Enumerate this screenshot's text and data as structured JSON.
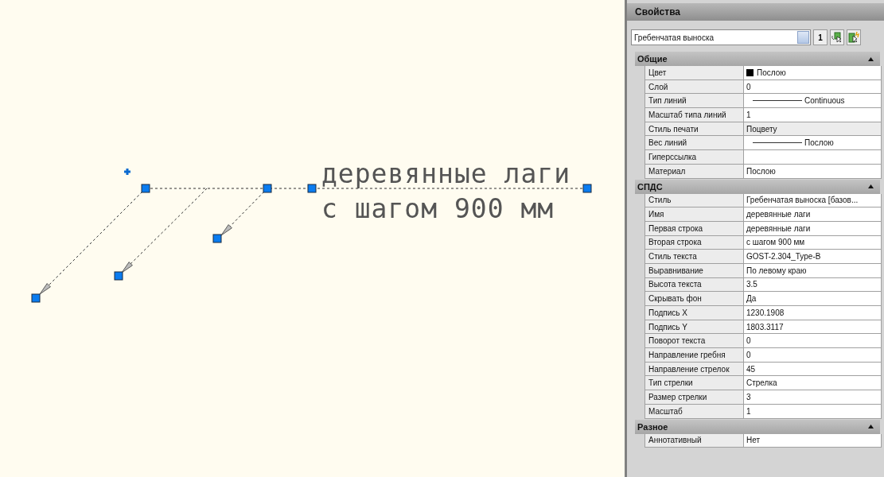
{
  "canvas": {
    "annotation_lines": [
      "деревянные лаги",
      "с шагом 900 мм"
    ]
  },
  "panel": {
    "title": "Свойства",
    "object_selector": {
      "value": "Гребенчатая выноска"
    },
    "toolbar": [
      {
        "kind": "number",
        "label": "1"
      },
      {
        "kind": "select-objects"
      },
      {
        "kind": "quick-select"
      }
    ],
    "sections": [
      {
        "title": "Общие",
        "expanded": true,
        "rows": [
          {
            "label": "Цвет",
            "value": "Послою",
            "kind": "color",
            "disabled": false
          },
          {
            "label": "Слой",
            "value": "0",
            "kind": "text",
            "disabled": false
          },
          {
            "label": "Тип линий",
            "value": "Continuous",
            "kind": "line",
            "disabled": false
          },
          {
            "label": "Масштаб типа линий",
            "value": "1",
            "kind": "text",
            "disabled": false
          },
          {
            "label": "Стиль печати",
            "value": "Поцвету",
            "kind": "text",
            "disabled": true
          },
          {
            "label": "Вес линий",
            "value": "Послою",
            "kind": "line",
            "disabled": false
          },
          {
            "label": "Гиперссылка",
            "value": "",
            "kind": "text",
            "disabled": false
          },
          {
            "label": "Материал",
            "value": "Послою",
            "kind": "text",
            "disabled": false
          }
        ]
      },
      {
        "title": "СПДС",
        "expanded": true,
        "rows": [
          {
            "label": "Стиль",
            "value": "Гребенчатая выноска [базов...",
            "kind": "text",
            "disabled": false
          },
          {
            "label": "Имя",
            "value": "деревянные лаги",
            "kind": "text",
            "disabled": false
          },
          {
            "label": "Первая строка",
            "value": "деревянные лаги",
            "kind": "text",
            "disabled": false
          },
          {
            "label": "Вторая строка",
            "value": "с шагом 900 мм",
            "kind": "text",
            "disabled": false
          },
          {
            "label": "Стиль текста",
            "value": "GOST-2.304_Type-B",
            "kind": "text",
            "disabled": false
          },
          {
            "label": "Выравнивание",
            "value": "По левому краю",
            "kind": "text",
            "disabled": false
          },
          {
            "label": "Высота текста",
            "value": "3.5",
            "kind": "text",
            "disabled": false
          },
          {
            "label": "Скрывать фон",
            "value": "Да",
            "kind": "text",
            "disabled": false
          },
          {
            "label": "Подпись X",
            "value": "1230.1908",
            "kind": "text",
            "disabled": false
          },
          {
            "label": "Подпись Y",
            "value": "1803.3117",
            "kind": "text",
            "disabled": false
          },
          {
            "label": "Поворот текста",
            "value": "0",
            "kind": "text",
            "disabled": false
          },
          {
            "label": "Направление гребня",
            "value": "0",
            "kind": "text",
            "disabled": false
          },
          {
            "label": "Направление стрелок",
            "value": "45",
            "kind": "text",
            "disabled": false
          },
          {
            "label": "Тип стрелки",
            "value": "Стрелка",
            "kind": "text",
            "disabled": false
          },
          {
            "label": "Размер стрелки",
            "value": "3",
            "kind": "text",
            "disabled": false
          },
          {
            "label": "Масштаб",
            "value": "1",
            "kind": "text",
            "disabled": false
          }
        ]
      },
      {
        "title": "Разное",
        "expanded": true,
        "rows": [
          {
            "label": "Аннотативный",
            "value": "Нет",
            "kind": "text",
            "disabled": false
          }
        ]
      }
    ]
  }
}
